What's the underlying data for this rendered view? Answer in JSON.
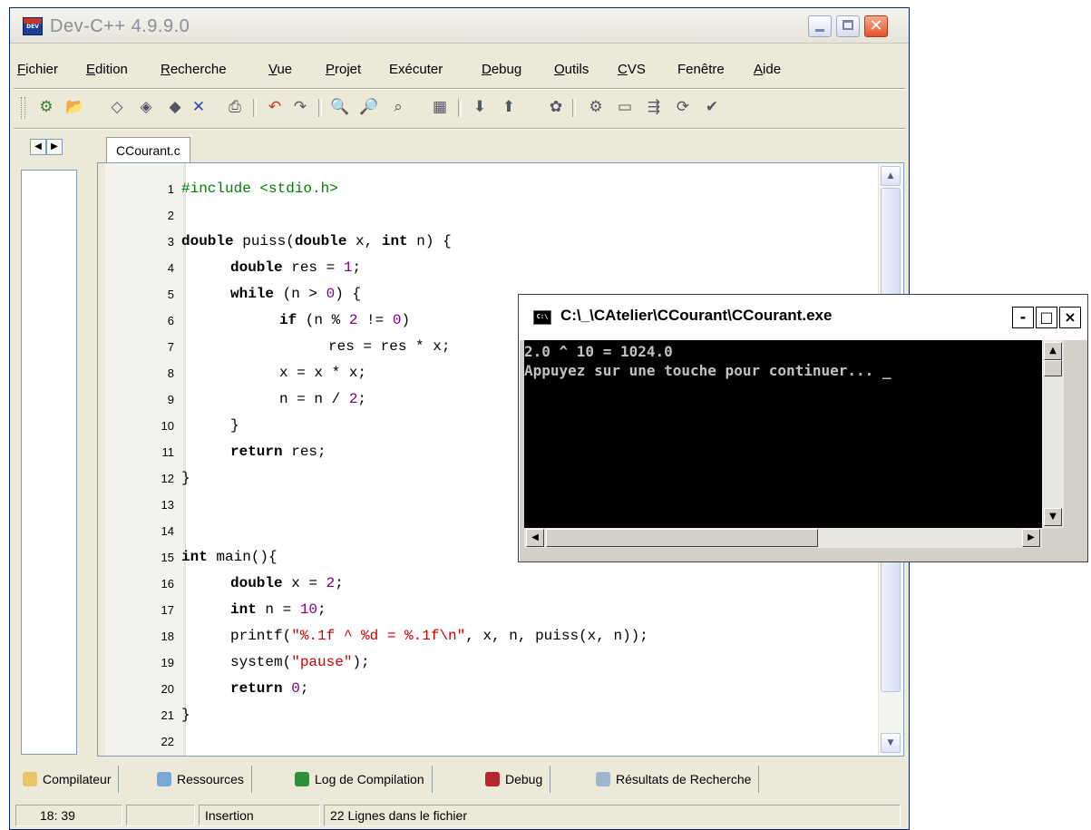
{
  "devcpp": {
    "title": "Dev-C++ 4.9.9.0",
    "menu": [
      {
        "u": "F",
        "rest": "ichier"
      },
      {
        "u": "E",
        "rest": "dition"
      },
      {
        "u": "R",
        "rest": "echerche"
      },
      {
        "u": "V",
        "rest": "ue"
      },
      {
        "u": "P",
        "rest": "rojet"
      },
      {
        "u": "",
        "rest": "Exécuter"
      },
      {
        "u": "D",
        "rest": "ebug"
      },
      {
        "u": "O",
        "rest": "utils"
      },
      {
        "u": "C",
        "rest": "VS"
      },
      {
        "u": "",
        "rest": "Fenêtre"
      },
      {
        "u": "A",
        "rest": "ide"
      }
    ],
    "file_tab": "CCourant.c",
    "code_lines": [
      "1",
      "2",
      "3",
      "4",
      "5",
      "6",
      "7",
      "8",
      "9",
      "10",
      "11",
      "12",
      "13",
      "14",
      "15",
      "16",
      "17",
      "18",
      "19",
      "20",
      "21",
      "22"
    ],
    "code": {
      "l1": "#include <stdio.h>",
      "l3a": "double",
      "l3b": " puiss(",
      "l3c": "double",
      "l3d": " x, ",
      "l3e": "int",
      "l3f": " n) {",
      "l4a": "double",
      "l4b": " res = ",
      "l4c": "1",
      "l4d": ";",
      "l5a": "while",
      "l5b": " (n > ",
      "l5c": "0",
      "l5d": ") {",
      "l6a": "if",
      "l6b": " (n % ",
      "l6c": "2",
      "l6d": " != ",
      "l6e": "0",
      "l6f": ")",
      "l7": "res = res * x;",
      "l8": "x = x * x;",
      "l9a": "n = n / ",
      "l9b": "2",
      "l9c": ";",
      "l10": "}",
      "l11a": "return",
      "l11b": " res;",
      "l12": "}",
      "l15a": "int",
      "l15b": " main(){",
      "l16a": "double",
      "l16b": " x = ",
      "l16c": "2",
      "l16d": ";",
      "l17a": "int",
      "l17b": " n = ",
      "l17c": "10",
      "l17d": ";",
      "l18a": "printf(",
      "l18b": "\"%.1f ^ %d = %.1f\\n\"",
      "l18c": ", x, n, puiss(x, n));",
      "l19a": "system(",
      "l19b": "\"pause\"",
      "l19c": ");",
      "l20a": "return",
      "l20b": " ",
      "l20c": "0",
      "l20d": ";",
      "l21": "}"
    },
    "bottom_tabs": [
      "Compilateur",
      "Ressources",
      "Log de Compilation",
      "Debug",
      "Résultats de Recherche"
    ],
    "status": {
      "position": "18: 39",
      "mode": "Insertion",
      "lines": "22 Lignes dans le fichier"
    }
  },
  "console": {
    "title": "C:\\_\\CAtelier\\CCourant\\CCourant.exe",
    "output_line1": "2.0 ^ 10 = 1024.0",
    "output_line2": "Appuyez sur une touche pour continuer... _"
  }
}
